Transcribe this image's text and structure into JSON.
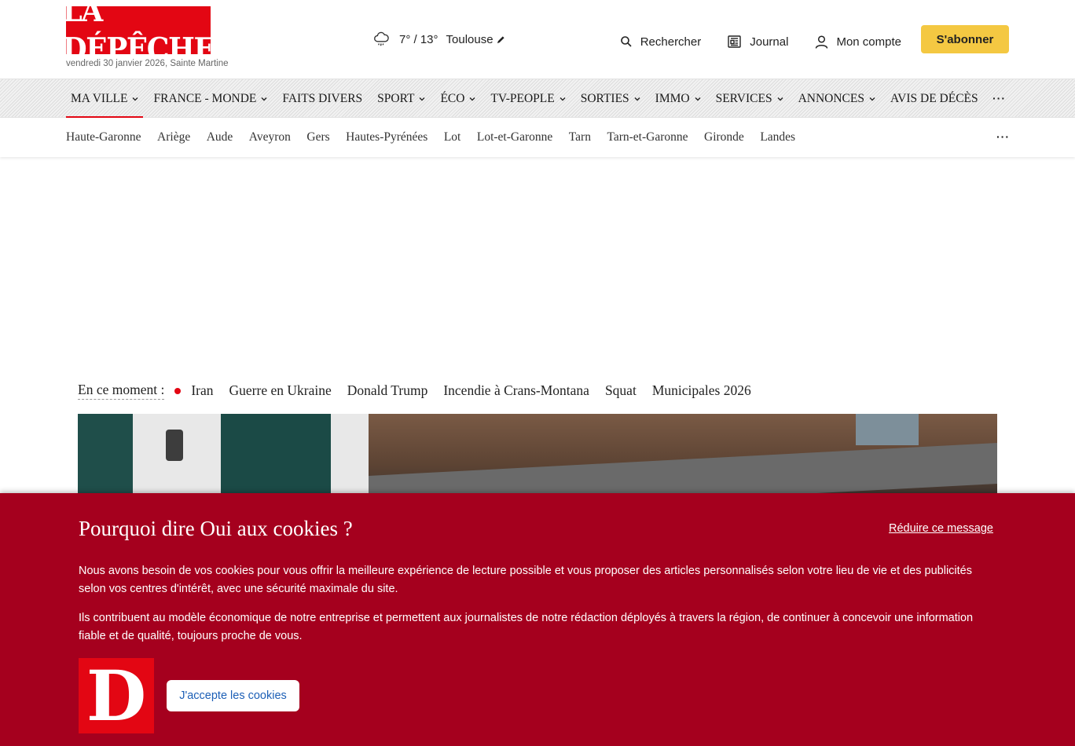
{
  "header": {
    "logo_text": "LA DÉPÊCHE",
    "date_line": "vendredi 30 janvier 2026, Sainte Martine",
    "weather": {
      "temperature": "7° / 13°",
      "city": "Toulouse",
      "icon": "rain-cloud-icon"
    },
    "actions": {
      "search_label": "Rechercher",
      "journal_label": "Journal",
      "account_label": "Mon compte",
      "subscribe_label": "S'abonner"
    }
  },
  "main_nav": {
    "items": [
      {
        "label": "MA VILLE",
        "has_dropdown": true,
        "active": true
      },
      {
        "label": "FRANCE - MONDE",
        "has_dropdown": true
      },
      {
        "label": "FAITS DIVERS",
        "has_dropdown": false
      },
      {
        "label": "SPORT",
        "has_dropdown": true
      },
      {
        "label": "ÉCO",
        "has_dropdown": true
      },
      {
        "label": "TV-PEOPLE",
        "has_dropdown": true
      },
      {
        "label": "SORTIES",
        "has_dropdown": true
      },
      {
        "label": "IMMO",
        "has_dropdown": true
      },
      {
        "label": "SERVICES",
        "has_dropdown": true
      },
      {
        "label": "ANNONCES",
        "has_dropdown": true
      },
      {
        "label": "AVIS DE DÉCÈS",
        "has_dropdown": false
      }
    ],
    "more_label": "···"
  },
  "region_nav": {
    "items": [
      "Haute-Garonne",
      "Ariège",
      "Aude",
      "Aveyron",
      "Gers",
      "Hautes-Pyrénées",
      "Lot",
      "Lot-et-Garonne",
      "Tarn",
      "Tarn-et-Garonne",
      "Gironde",
      "Landes"
    ],
    "more_label": "···"
  },
  "trending": {
    "label": "En ce moment :",
    "items": [
      "Iran",
      "Guerre en Ukraine",
      "Donald Trump",
      "Incendie à Crans-Montana",
      "Squat",
      "Municipales 2026"
    ]
  },
  "cookie_banner": {
    "title": "Pourquoi dire Oui aux cookies ?",
    "reduce_label": "Réduire ce message",
    "paragraph_1": "Nous avons besoin de vos cookies pour vous offrir la meilleure expérience de lecture possible et vous proposer des articles personnalisés selon votre lieu de vie et des publicités selon vos centres d'intérêt, avec une sécurité maximale du site.",
    "paragraph_2": "Ils contribuent au modèle économique de notre entreprise et permettent aux journalistes de notre rédaction déployés à travers la région, de continuer à concevoir une information fiable et de qualité, toujours proche de vous.",
    "logo_letter": "D",
    "accept_label": "J'accepte les cookies"
  },
  "colors": {
    "brand_red": "#e30613",
    "cookie_bg": "#a5001e",
    "subscribe_yellow": "#f4c842",
    "accept_text_blue": "#1c5fb6"
  }
}
